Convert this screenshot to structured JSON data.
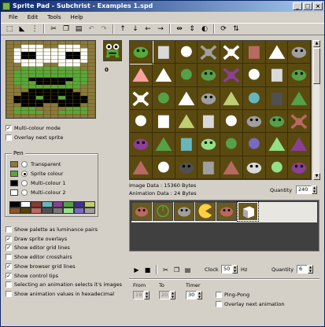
{
  "window": {
    "title": "Sprite Pad - Subchrist - Examples 1.spd",
    "controls": {
      "minimize": "_",
      "maximize": "□",
      "close": "×"
    }
  },
  "menu": [
    "File",
    "Edit",
    "Tools",
    "Help"
  ],
  "toolbar_icons": [
    "select-icon",
    "fill-icon",
    "dither-icon",
    "cut-icon",
    "copy-icon",
    "paste-icon",
    "undo-icon",
    "redo-icon",
    "shift-up-icon",
    "shift-down-icon",
    "shift-left-icon",
    "shift-right-icon",
    "flip-horizontal-icon",
    "flip-vertical-icon",
    "reverse-icon",
    "rotate-icon",
    "swap-icon"
  ],
  "preview": {
    "index": "0"
  },
  "editor_options": {
    "multi_colour_mode": "Multi-colour mode",
    "overlay_next_sprite": "Overlay next sprite"
  },
  "pen": {
    "title": "Pen",
    "options": [
      {
        "label": "Transparent",
        "color": "#8a7a3e",
        "selected": false
      },
      {
        "label": "Sprite colour",
        "color": "#56a93a",
        "selected": true
      },
      {
        "label": "Multi-colour 1",
        "color": "#000000",
        "selected": false
      },
      {
        "label": "Multi-colour 2",
        "color": "#ffffff",
        "selected": false
      }
    ],
    "palette": [
      "#000000",
      "#ffffff",
      "#883932",
      "#67b6bd",
      "#8b3f96",
      "#55a049",
      "#40318d",
      "#bfce72",
      "#8b5429",
      "#574200",
      "#b86962",
      "#505050",
      "#787878",
      "#94e089",
      "#7869c4",
      "#9f9f9f"
    ]
  },
  "settings": [
    {
      "label": "Show palette as luminance pairs",
      "checked": false
    },
    {
      "label": "Draw sprite overlays",
      "checked": true
    },
    {
      "label": "Show editor grid lines",
      "checked": true
    },
    {
      "label": "Show editor crosshairs",
      "checked": false
    },
    {
      "label": "Show browser grid lines",
      "checked": true
    },
    {
      "label": "Show control tips",
      "checked": true
    },
    {
      "label": "Selecting an animation selects it's images",
      "checked": false
    },
    {
      "label": "Show animation values in hexadecimal",
      "checked": false
    }
  ],
  "browser": {
    "background": "#5a4a10",
    "sprites": [
      {
        "name": "frog",
        "color": "#56a93a"
      },
      {
        "name": "barrel",
        "color": "#d9d9d9"
      },
      {
        "name": "eyes",
        "color": "#ffffff"
      },
      {
        "name": "tank",
        "color": "#9f9f9f"
      },
      {
        "name": "skull-crossbones",
        "color": "#ffffff"
      },
      {
        "name": "block",
        "color": "#b86962"
      },
      {
        "name": "shoe",
        "color": "#ffffff"
      },
      {
        "name": "saucer",
        "color": "#9f9f9f"
      },
      {
        "name": "hand",
        "color": "#ffa0a0"
      },
      {
        "name": "diamond",
        "color": "#ffffff"
      },
      {
        "name": "ring",
        "color": "#55a049"
      },
      {
        "name": "frog-small",
        "color": "#55a049"
      },
      {
        "name": "spikes",
        "color": "#8b3f96"
      },
      {
        "name": "smiley",
        "color": "#ffffff"
      },
      {
        "name": "car",
        "color": "#d9d9d9"
      },
      {
        "name": "ship",
        "color": "#55a049"
      },
      {
        "name": "arrows",
        "color": "#ffffff"
      },
      {
        "name": "target",
        "color": "#55a049"
      },
      {
        "name": "star",
        "color": "#ffffff"
      },
      {
        "name": "crab",
        "color": "#9f9f9f"
      },
      {
        "name": "chevron",
        "color": "#bfce72"
      },
      {
        "name": "orb",
        "color": "#67b6bd"
      },
      {
        "name": "pod",
        "color": "#505050"
      },
      {
        "name": "leaf",
        "color": "#55a049"
      },
      {
        "name": "bubbles",
        "color": "#ffffff"
      },
      {
        "name": "computer",
        "color": "#ffffff"
      },
      {
        "name": "pear",
        "color": "#bfce72"
      },
      {
        "name": "shield",
        "color": "#d9d9d9"
      },
      {
        "name": "skull-small",
        "color": "#ffffff"
      },
      {
        "name": "ghost",
        "color": "#9f9f9f"
      },
      {
        "name": "dragon",
        "color": "#55a049"
      },
      {
        "name": "squid",
        "color": "#b86962"
      },
      {
        "name": "ufo",
        "color": "#8b3f96"
      },
      {
        "name": "pyramid",
        "color": "#55a049"
      },
      {
        "name": "can",
        "color": "#67b6bd"
      },
      {
        "name": "alien",
        "color": "#94e089"
      },
      {
        "name": "blob",
        "color": "#55a049"
      },
      {
        "name": "ball",
        "color": "#7869c4"
      },
      {
        "name": "crescent",
        "color": "#94e089"
      },
      {
        "name": "hat",
        "color": "#8b3f96"
      },
      {
        "name": "tree",
        "color": "#b86962"
      },
      {
        "name": "skull-big",
        "color": "#ffffff"
      },
      {
        "name": "walker",
        "color": "#505050"
      },
      {
        "name": "gun",
        "color": "#9f9f9f"
      },
      {
        "name": "bird",
        "color": "#b86962"
      },
      {
        "name": "heli",
        "color": "#d9d9d9"
      },
      {
        "name": "moon",
        "color": "#94e089"
      },
      {
        "name": "ufo-small",
        "color": "#8b3f96"
      }
    ]
  },
  "image_data": "Image Data : 15360 Bytes",
  "animation_data": "Animation Data : 24 Bytes",
  "quantity_label": "Quantity",
  "quantity_value": "240",
  "animation": {
    "frames": [
      "walker",
      "ring",
      "dragon",
      "pacman",
      "crab",
      "cube"
    ]
  },
  "anim_controls": {
    "clock_label": "Clock",
    "clock_value": "50",
    "clock_unit": "Hz",
    "quantity_label": "Quantity",
    "quantity_value": "6",
    "from_label": "From",
    "from_value": "19",
    "to_label": "To",
    "to_value": "20",
    "timer_label": "Timer",
    "timer_value": "30",
    "ping_pong": "Ping-Pong",
    "overlay_next_animation": "Overlay next animation"
  }
}
